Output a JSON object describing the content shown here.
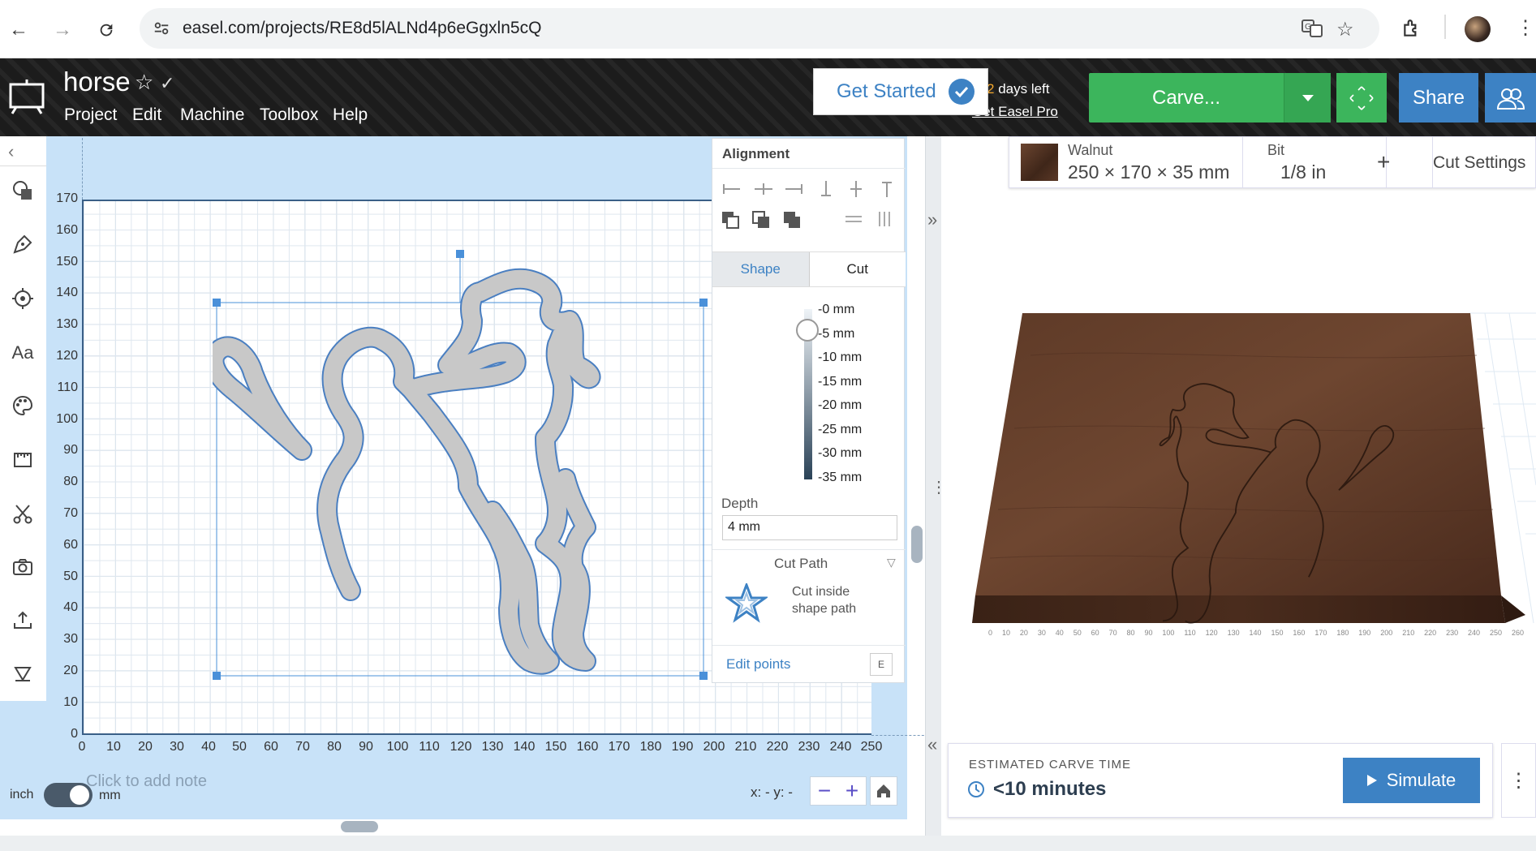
{
  "browser": {
    "url": "easel.com/projects/RE8d5lALNd4p6eGgxln5cQ"
  },
  "header": {
    "project_title": "horse",
    "menu": [
      "Project",
      "Edit",
      "Machine",
      "Toolbox",
      "Help"
    ],
    "get_started": "Get Started",
    "days_left_num": "2",
    "days_left_text": " days left",
    "get_pro": "Get Easel Pro",
    "carve": "Carve...",
    "share": "Share"
  },
  "canvas": {
    "y_ticks": [
      "170",
      "160",
      "150",
      "140",
      "130",
      "120",
      "110",
      "100",
      "90",
      "80",
      "70",
      "60",
      "50",
      "40",
      "30",
      "20",
      "10",
      "0"
    ],
    "x_ticks": [
      "0",
      "10",
      "20",
      "30",
      "40",
      "50",
      "60",
      "70",
      "80",
      "90",
      "100",
      "110",
      "120",
      "130",
      "140",
      "150",
      "160",
      "170",
      "180",
      "190",
      "200",
      "210",
      "220",
      "230",
      "240",
      "250"
    ],
    "unit_inch": "inch",
    "unit_mm": "mm",
    "note_placeholder": "Click to add note",
    "coords": "x: - y: -"
  },
  "panel": {
    "alignment_title": "Alignment",
    "tab_shape": "Shape",
    "tab_cut": "Cut",
    "depth_marks": [
      "-0 mm",
      "-5 mm",
      "-10 mm",
      "-15 mm",
      "-20 mm",
      "-25 mm",
      "-30 mm",
      "-35 mm"
    ],
    "depth_label": "Depth",
    "depth_value": "4 mm",
    "cut_path_title": "Cut Path",
    "cut_path_desc_1": "Cut inside",
    "cut_path_desc_2": "shape path",
    "edit_points": "Edit points",
    "edit_points_key": "E"
  },
  "material": {
    "name": "Walnut",
    "dims": "250 × 170 × 35 mm",
    "bit_label": "Bit",
    "bit_value": "1/8 in",
    "cut_settings": "Cut Settings"
  },
  "preview": {
    "ruler": [
      "0",
      "10",
      "20",
      "30",
      "40",
      "50",
      "60",
      "70",
      "80",
      "90",
      "100",
      "110",
      "120",
      "130",
      "140",
      "150",
      "160",
      "170",
      "180",
      "190",
      "200",
      "210",
      "220",
      "230",
      "240",
      "250",
      "260"
    ],
    "est_label": "ESTIMATED CARVE TIME",
    "est_value": "<10 minutes",
    "simulate": "Simulate"
  },
  "colors": {
    "carve_green": "#3cb55c",
    "accent_blue": "#3d82c4",
    "canvas_bg": "#c8e2f8"
  }
}
